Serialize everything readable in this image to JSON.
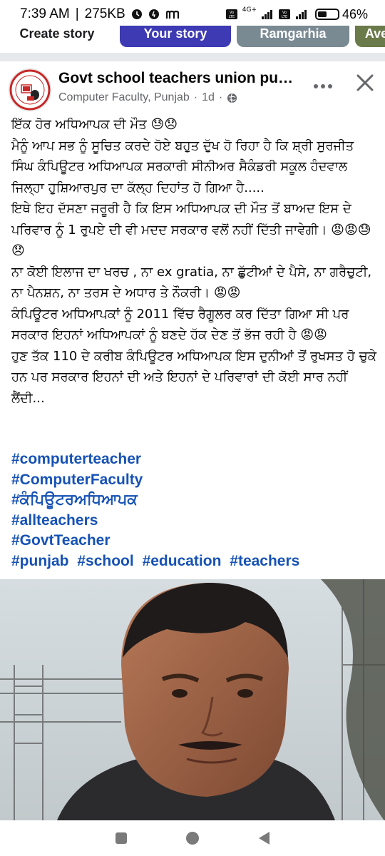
{
  "status_bar": {
    "time": "7:39 AM",
    "data_speed": "275KB",
    "network": "4G+",
    "battery": "46%",
    "battery_level": 0.46
  },
  "stories": {
    "create_label": "Create story",
    "your_label": "Your story",
    "other_label": "Ramgarhia",
    "other2_label": "Ave"
  },
  "post": {
    "page_name": "Govt school teachers union punjab",
    "author": "Computer Faculty, Punjab",
    "time": "1d",
    "body": [
      "ਇੱਕ ਹੋਰ ਅਧਿਆਪਕ ਦੀ ਮੌਤ 😓😞",
      "ਮੈਨੂੰ ਆਪ ਸਭ ਨੂੰ ਸੂਚਿਤ ਕਰਦੇ ਹੋਏ ਬਹੁਤ ਦੁੱਖ ਹੋ ਰਿਹਾ ਹੈ ਕਿ ਸ਼੍ਰੀ ਸੁਰਜੀਤ ਸਿੰਘ ਕੰਪਿਊਟਰ ਅਧਿਆਪਕ ਸਰਕਾਰੀ ਸੀਨੀਅਰ ਸੈਕੰਡਰੀ ਸਕੂਲ ਹੰਦਵਾਲ ਜਿਲ੍ਹਾ ਹੁਸ਼ਿਆਰਪੁਰ ਦਾ ਕੱਲ੍ਹ ਦਿਹਾਂਤ ਹੋ ਗਿਆ ਹੈ.....",
      "ਇਥੇ ਇਹ ਦੱਸਣਾ ਜਰੂਰੀ ਹੈ ਕਿ ਇਸ ਅਧਿਆਪਕ ਦੀ ਮੌਤ ਤੋਂ ਬਾਅਦ ਇਸ ਦੇ ਪਰਿਵਾਰ ਨੂੰ 1 ਰੁਪਏ ਦੀ ਵੀ ਮਦਦ ਸਰਕਾਰ ਵਲੋਂ ਨਹੀਂ ਦਿੱਤੀ ਜਾਵੇਗੀ। 😡😡😓😞",
      "ਨਾ ਕੋਈ ਇਲਾਜ ਦਾ ਖਰਚ , ਨਾ ex gratia, ਨਾ ਛੁੱਟੀਆਂ ਦੇ ਪੈਸੇ, ਨਾ ਗਰੈਚੁਟੀ, ਨਾ ਪੈਨਸ਼ਨ, ਨਾ ਤਰਸ ਦੇ ਅਧਾਰ ਤੇ ਨੌਕਰੀ। 😡😡",
      " ਕੰਪਿਊਟਰ ਅਧਿਆਪਕਾਂ ਨੂੰ 2011 ਵਿੱਚ ਰੈਗੂਲਰ ਕਰ ਦਿੱਤਾ ਗਿਆ ਸੀ ਪਰ ਸਰਕਾਰ ਇਹਨਾਂ ਅਧਿਆਪਕਾਂ ਨੂੰ ਬਣਦੇ ਹੱਕ ਦੇਣ ਤੋਂ ਭੱਜ ਰਹੀ ਹੈ 😡😡",
      "ਹੁਣ ਤੱਕ 110 ਦੇ ਕਰੀਬ ਕੰਪਿਊਟਰ ਅਧਿਆਪਕ ਇਸ ਦੁਨੀਆਂ ਤੋਂ ਰੁਖਸਤ ਹੋ ਚੁਕੇ ਹਨ ਪਰ ਸਰਕਾਰ ਇਹਨਾਂ ਦੀ ਅਤੇ ਇਹਨਾਂ ਦੇ ਪਰਿਵਾਰਾਂ ਦੀ ਕੋਈ ਸਾਰ ਨਹੀਂ ਲੈਂਦੀ..."
    ],
    "hashtags": {
      "h1": "#computerteacher",
      "h2": "#ComputerFaculty",
      "h3": "#ਕੰਪਿਊਟਰਅਧਿਆਪਕ",
      "h4": "#allteachers",
      "h5": "#GovtTeacher",
      "h6a": "#punjab",
      "h6b": "#school",
      "h6c": "#education",
      "h6d": "#teachers"
    }
  },
  "icons": {
    "more": "more-horizontal-icon",
    "close": "close-icon",
    "privacy": "globe-icon",
    "nav_recent": "recents-icon",
    "nav_home": "home-icon",
    "nav_back": "back-icon"
  },
  "colors": {
    "hashtag": "#1652b5",
    "meta": "#65676b",
    "story_yours": "#3d3ab3"
  }
}
